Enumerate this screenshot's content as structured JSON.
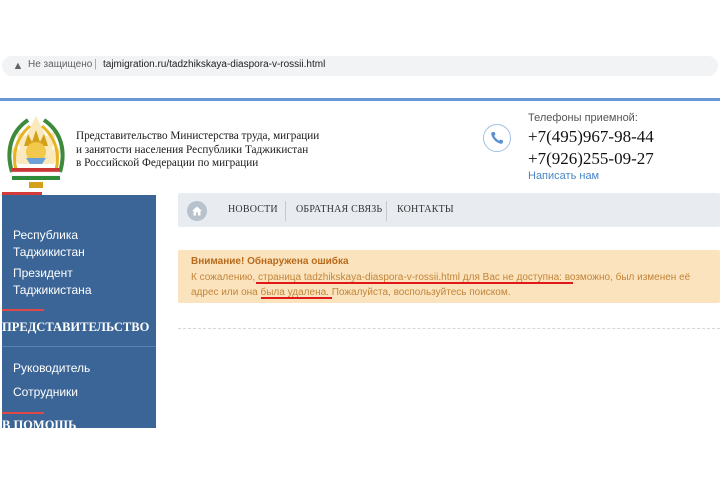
{
  "browser": {
    "security_text": "Не защищено",
    "separator": "|",
    "url": "tajmigration.ru/tadzhikskaya-diaspora-v-rossii.html"
  },
  "header": {
    "org_lines": [
      "Представительство Министерства труда, миграции",
      "и занятости населения Республики Таджикистан",
      "в Российской Федерации по миграции"
    ],
    "phones_label": "Телефоны приемной:",
    "phone1": "+7(495)967-98-44",
    "phone2": "+7(926)255-09-27",
    "write_link": "Написать нам"
  },
  "sidebar": {
    "link1": "Республика Таджикистан",
    "link2": "Президент Таджикистана",
    "section": "ПРЕДСТАВИТЕЛЬСТВО",
    "link3": "Руководитель",
    "link4": "Сотрудники",
    "partial": "В ПОМОЩЬ"
  },
  "nav": {
    "news": "НОВОСТИ",
    "feedback": "ОБРАТНАЯ СВЯЗЬ",
    "contacts": "КОНТАКТЫ"
  },
  "error": {
    "title": "Внимание! Обнаружена ошибка",
    "p1": "К сожалению, ",
    "p2": "страница tadzhikskaya-diaspora-v-rossii.html для Вас не доступна",
    "p3": ": возможно, был изменен её адрес или она ",
    "p4": "была удалена",
    "p5": ". Пожалуйста, воспользуйтесь поиском."
  },
  "colors": {
    "sidebar": "#3b6596",
    "accent_red": "#e04848",
    "error_bg": "#fbe3bd",
    "underline": "#e01818"
  }
}
